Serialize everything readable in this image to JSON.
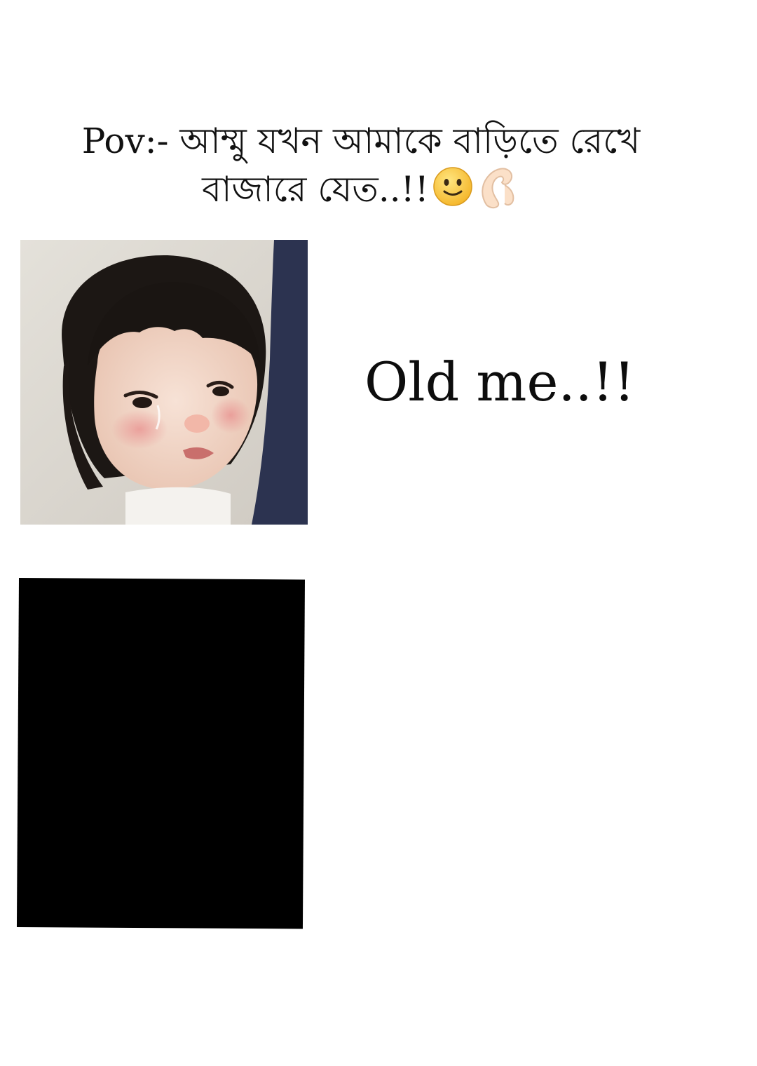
{
  "caption": {
    "line1": "Pov:- আম্মু যখন আমাকে বাড়িতে রেখে",
    "line2": "বাজারে যেত..!!",
    "emojis": [
      "slightly-smiling-face-icon",
      "pinching-hand-icon"
    ]
  },
  "photo": {
    "subject": "crying-toddler-photo"
  },
  "old_me_label": "Old me..!!",
  "colors": {
    "background": "#ffffff",
    "text": "#111111",
    "panel": "#000000"
  }
}
